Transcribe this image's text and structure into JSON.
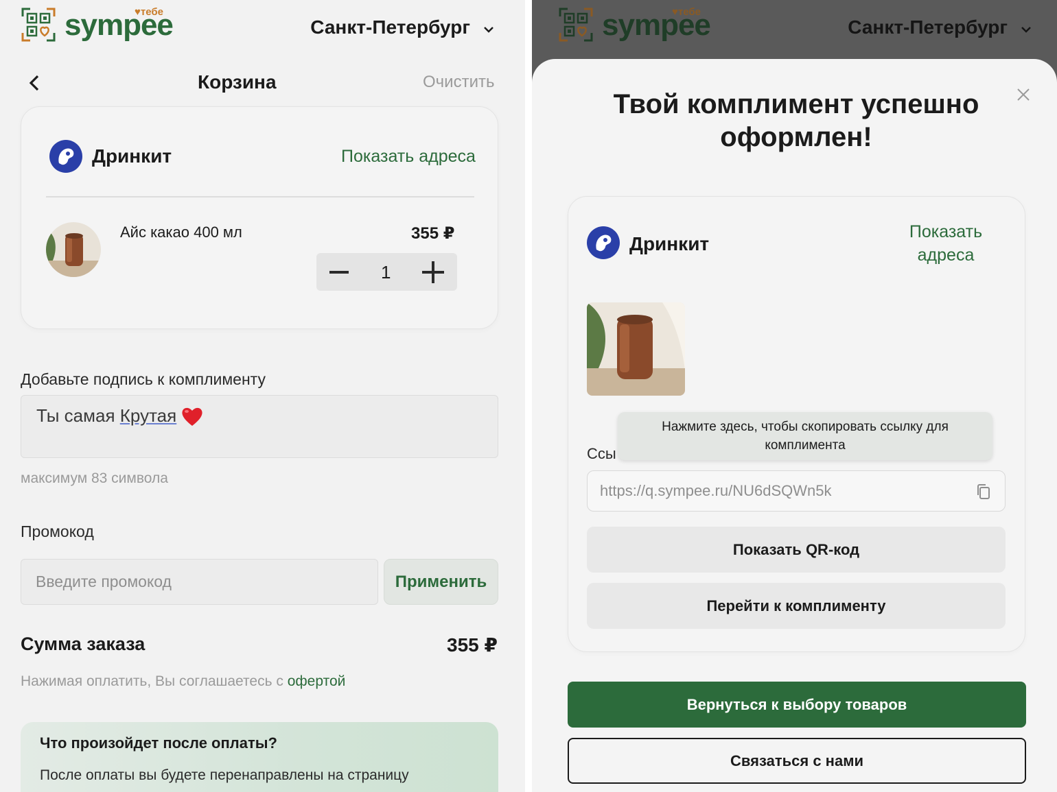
{
  "colors": {
    "brand_green": "#2c6b3b",
    "brand_accent": "#c97c2a",
    "brand_icon_blue": "#2a3fa8",
    "panel_bg": "#f2f2f2",
    "overlay_bg": "#5a5a5a"
  },
  "header": {
    "logo_text": "sympee",
    "logo_superscript": "тебе",
    "logo_icon": "qr-heart-icon",
    "city": "Санкт-Петербург",
    "city_icon": "chevron-down-icon"
  },
  "cart": {
    "back_icon": "chevron-left-icon",
    "title": "Корзина",
    "clear_label": "Очистить",
    "store_card": {
      "brand_name": "Дринкит",
      "brand_icon": "drinkit-logo-icon",
      "show_addresses_label": "Показать адреса",
      "item": {
        "name": "Айс какао 400 мл",
        "price": "355 ₽",
        "quantity": "1"
      }
    },
    "signature": {
      "label": "Добавьте подпись к комплименту",
      "value_plain": "Ты самая ",
      "value_underlined": "Крутая",
      "emoji": "heart-emoji",
      "hint": "максимум 83 символа"
    },
    "promo": {
      "label": "Промокод",
      "placeholder": "Введите промокод",
      "apply_label": "Применить"
    },
    "total": {
      "label": "Сумма заказа",
      "value": "355 ₽"
    },
    "agreement": {
      "text": "Нажимая оплатить, Вы соглашаетесь с ",
      "link": "офертой"
    },
    "info": {
      "title": "Что произойдет после оплаты?",
      "text": "После оплаты вы будете перенаправлены на страницу"
    }
  },
  "success": {
    "close_icon": "close-icon",
    "title_line1": "Твой комплимент успешно",
    "title_line2": "оформлен!",
    "card": {
      "brand_name": "Дринкит",
      "show_addresses_line1": "Показать",
      "show_addresses_line2": "адреса",
      "tooltip_line1": "Нажмите здесь, чтобы скопировать ссылку для",
      "tooltip_line2": "комплимента",
      "link_label_visible": "Ссы",
      "link_url": "https://q.sympee.ru/NU6dSQWn5k",
      "copy_icon": "copy-icon",
      "qr_button": "Показать QR-код",
      "go_button": "Перейти к комплименту"
    },
    "back_button": "Вернуться к выбору товаров",
    "contact_button": "Связаться с нами"
  }
}
